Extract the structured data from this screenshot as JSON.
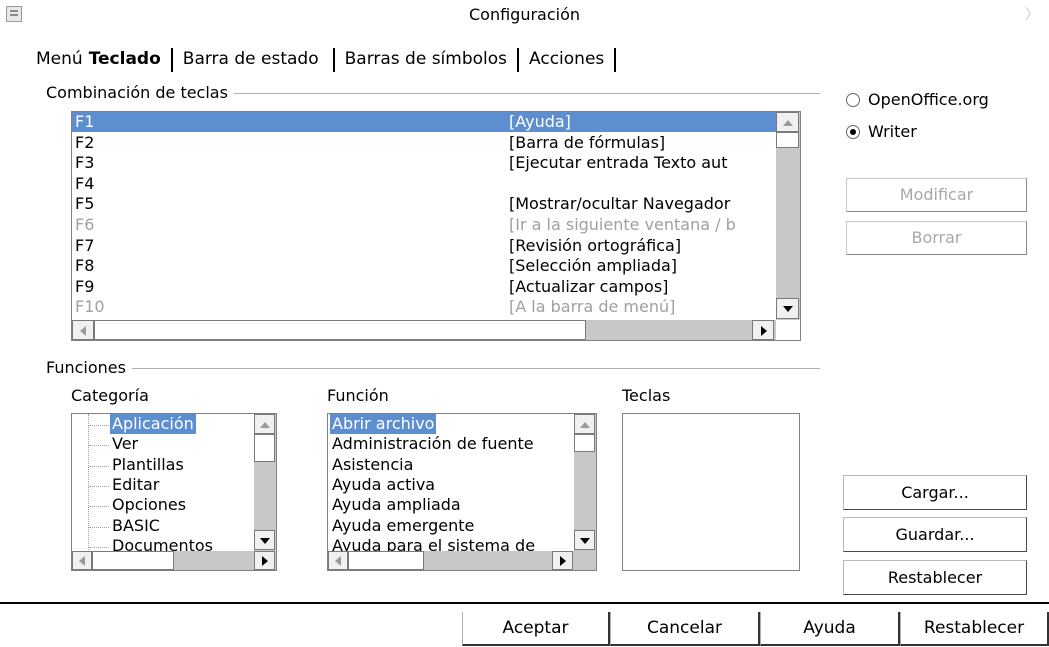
{
  "window": {
    "title": "Configuración",
    "app_icon": "window-menu-icon",
    "close_icon": "close-icon"
  },
  "tabs": [
    {
      "label": "Menú",
      "active": false
    },
    {
      "label": "Teclado",
      "active": true
    },
    {
      "label": "Barra de estado",
      "active": false
    },
    {
      "label": "Barras de símbolos",
      "active": false
    },
    {
      "label": "Acciones",
      "active": false
    }
  ],
  "shortcuts": {
    "group_label": "Combinación de teclas",
    "rows": [
      {
        "key": "F1",
        "command": "[Ayuda]",
        "selected": true,
        "dim": false
      },
      {
        "key": "F2",
        "command": "[Barra de fórmulas]",
        "selected": false,
        "dim": false
      },
      {
        "key": "F3",
        "command": "[Ejecutar entrada Texto aut",
        "selected": false,
        "dim": false
      },
      {
        "key": "F4",
        "command": "",
        "selected": false,
        "dim": false
      },
      {
        "key": "F5",
        "command": "[Mostrar/ocultar Navegador",
        "selected": false,
        "dim": false
      },
      {
        "key": "F6",
        "command": "[Ir a la siguiente ventana / b",
        "selected": false,
        "dim": true
      },
      {
        "key": "F7",
        "command": "[Revisión ortográfica]",
        "selected": false,
        "dim": false
      },
      {
        "key": "F8",
        "command": "[Selección ampliada]",
        "selected": false,
        "dim": false
      },
      {
        "key": "F9",
        "command": "[Actualizar campos]",
        "selected": false,
        "dim": false
      },
      {
        "key": "F10",
        "command": "[A la barra de menú]",
        "selected": false,
        "dim": true
      }
    ]
  },
  "scope": {
    "options": [
      {
        "label": "OpenOffice.org",
        "checked": false
      },
      {
        "label": "Writer",
        "checked": true
      }
    ]
  },
  "side_buttons": {
    "modify": "Modificar",
    "delete": "Borrar"
  },
  "functions": {
    "group_label": "Funciones",
    "category_label": "Categoría",
    "function_label": "Función",
    "keys_label": "Teclas",
    "categories": [
      "Aplicación",
      "Ver",
      "Plantillas",
      "Editar",
      "Opciones",
      "BASIC",
      "Documentos"
    ],
    "functions_list": [
      "Abrir archivo",
      "Administración de fuente",
      "Asistencia",
      "Ayuda activa",
      "Ayuda ampliada",
      "Ayuda emergente",
      "Ayuda para el sistema de"
    ],
    "keys": []
  },
  "file_buttons": {
    "load": "Cargar...",
    "save": "Guardar...",
    "reset": "Restablecer"
  },
  "bottom_buttons": {
    "ok": "Aceptar",
    "cancel": "Cancelar",
    "help": "Ayuda",
    "reset": "Restablecer"
  },
  "colors": {
    "selection": "#5d8fd0",
    "scrollbar": "#c8c8c8",
    "disabled_text": "#a8a8a8"
  }
}
